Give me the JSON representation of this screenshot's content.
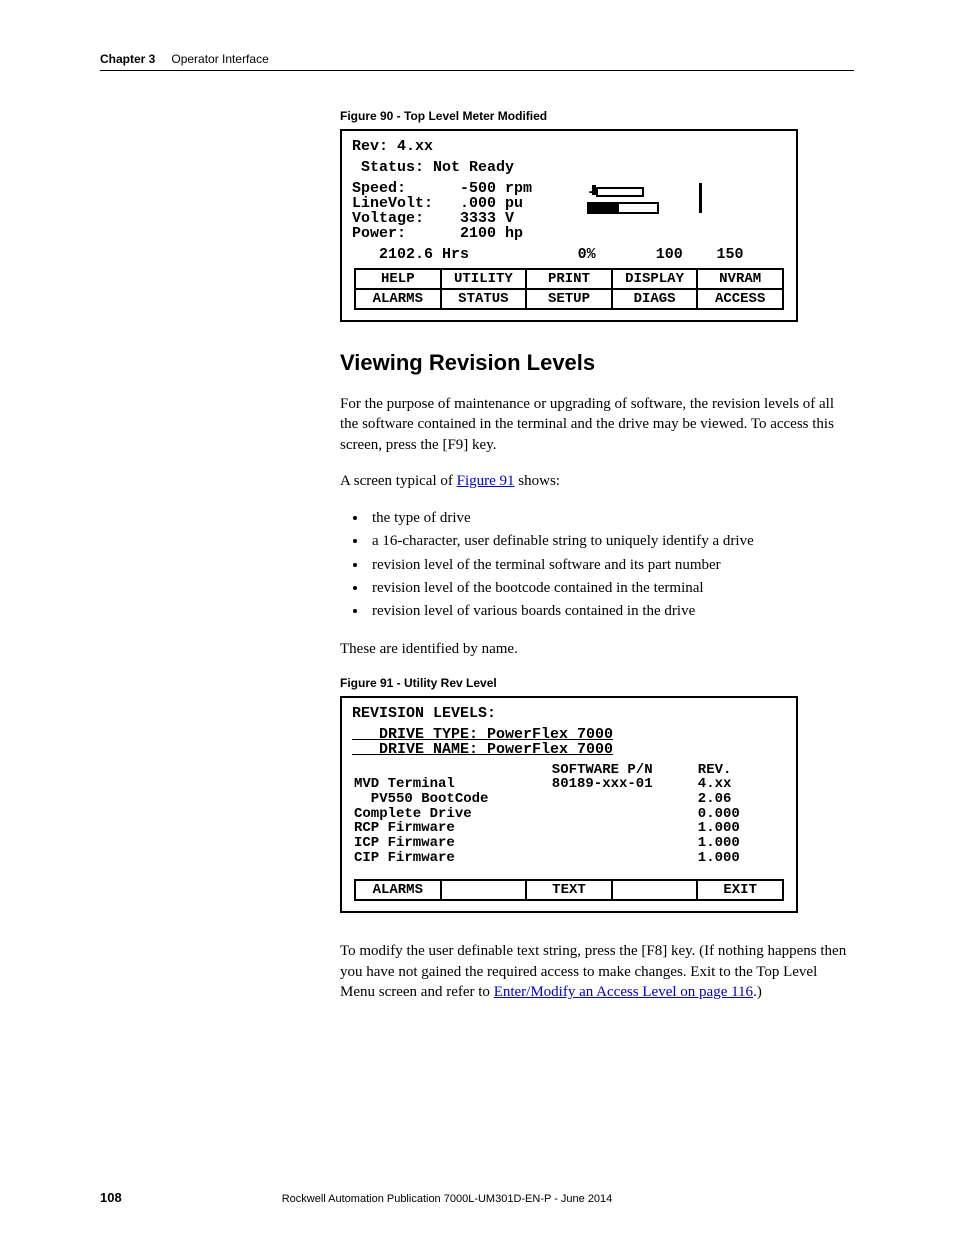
{
  "header": {
    "chapter": "Chapter 3",
    "title": "Operator Interface"
  },
  "fig90": {
    "caption": "Figure 90 - Top Level Meter Modified",
    "rev": "Rev: 4.xx",
    "status": " Status: Not Ready",
    "meters": "Speed:      -500 rpm\nLineVolt:   .000 pu\nVoltage:    3333 V\nPower:      2100 hp",
    "hours": "   2102.6 Hrs",
    "scale0": "0%",
    "scale100": "100",
    "scale150": "150",
    "softkeys_top": [
      "HELP",
      "UTILITY",
      "PRINT",
      "DISPLAY",
      "NVRAM"
    ],
    "softkeys_bot": [
      "ALARMS",
      "STATUS",
      "SETUP",
      "DIAGS",
      "ACCESS"
    ]
  },
  "section": {
    "heading": "Viewing Revision Levels",
    "p1": "For the purpose of maintenance or upgrading of software, the revision levels of all the software contained in the terminal and the drive may be viewed. To access this screen, press the [F9] key.",
    "p2_pre": "A screen typical of ",
    "p2_link": "Figure 91",
    "p2_post": " shows:",
    "bullets": [
      "the type of drive",
      "a 16-character, user definable string to uniquely identify a drive",
      "revision level of the terminal software and its part number",
      "revision level of the bootcode contained in the terminal",
      "revision level of various boards contained in the drive"
    ],
    "p3": "These are identified by name."
  },
  "fig91": {
    "caption": "Figure 91 - Utility Rev Level",
    "title": "REVISION LEVELS:",
    "drive": "   DRIVE TYPE: PowerFlex 7000\n   DRIVE NAME: PowerFlex 7000",
    "col1": "\nMVD Terminal\n  PV550 BootCode\nComplete Drive\nRCP Firmware\nICP Firmware\nCIP Firmware",
    "col2": "SOFTWARE P/N\n80189-xxx-01\n\n\n\n\n",
    "col3": " REV.\n 4.xx\n 2.06\n 0.000\n 1.000\n 1.000\n 1.000",
    "softkeys": [
      "ALARMS",
      "",
      "TEXT",
      "",
      "EXIT"
    ]
  },
  "closing": {
    "pre": "To modify the user definable text string, press the [F8] key. (If nothing happens then you have not gained the required access to make changes. Exit to the Top Level Menu screen and refer to ",
    "link": "Enter/Modify an Access Level  on page 116",
    "post": ".)"
  },
  "footer": {
    "page": "108",
    "pub": "Rockwell Automation Publication 7000L-UM301D-EN-P - June 2014"
  }
}
